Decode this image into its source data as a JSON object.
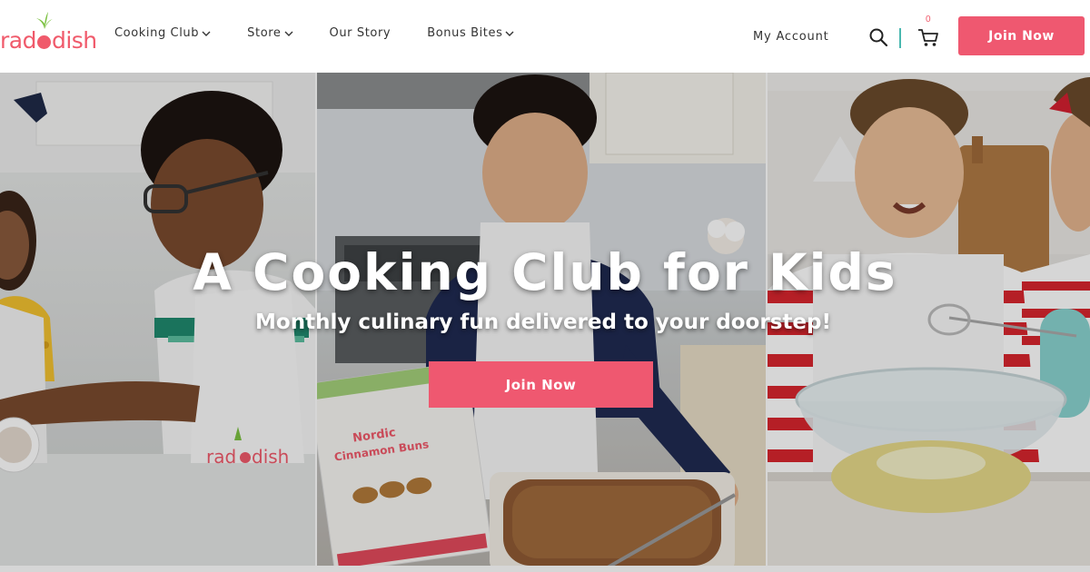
{
  "brand": {
    "logo_text_start": "rad",
    "logo_text_end": "dish",
    "accent": "#ef5870",
    "leaf_color": "#7cc142",
    "divider_color": "#4ab8b0"
  },
  "nav": {
    "items": [
      {
        "label": "Cooking Club",
        "has_dropdown": true
      },
      {
        "label": "Store",
        "has_dropdown": true
      },
      {
        "label": "Our Story",
        "has_dropdown": false
      },
      {
        "label": "Bonus Bites",
        "has_dropdown": true
      }
    ],
    "my_account": "My Account",
    "cart_count": "0",
    "join_label": "Join Now",
    "icons": [
      "search-icon",
      "cart-icon",
      "chevron-down-icon"
    ]
  },
  "hero": {
    "title": "A Cooking Club for Kids",
    "subtitle": "Monthly culinary fun delivered to your doorstep!",
    "cta_label": "Join Now",
    "apron_logo": "radish",
    "recipe_card_title": "Nordic Cinnamon Buns"
  }
}
